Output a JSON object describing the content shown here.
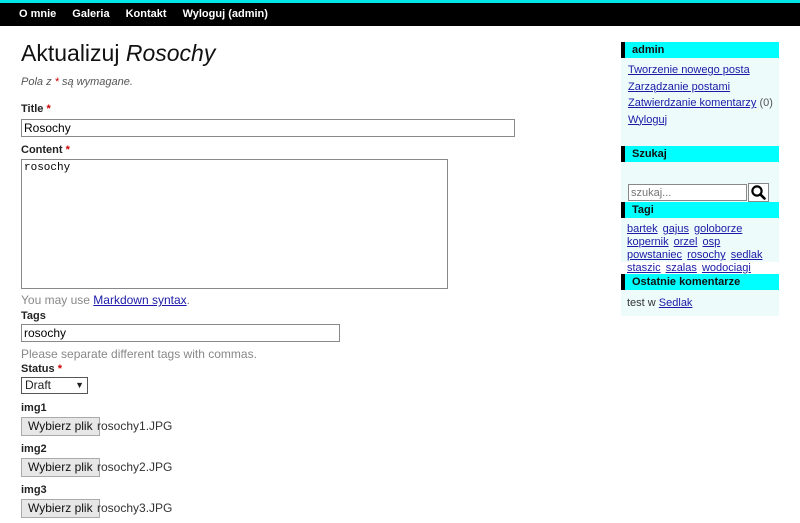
{
  "nav": {
    "items": [
      "O mnie",
      "Galeria",
      "Kontakt",
      "Wyloguj (admin)"
    ]
  },
  "page": {
    "title_prefix": "Aktualizuj ",
    "title_name": "Rosochy",
    "note_before": "Pola z ",
    "note_star": "*",
    "note_after": " są wymagane."
  },
  "form": {
    "title_label": "Title",
    "title_value": "Rosochy",
    "content_label": "Content",
    "content_value": "rosochy",
    "markdown_hint_prefix": "You may use ",
    "markdown_link": "Markdown syntax",
    "markdown_hint_suffix": ".",
    "tags_label": "Tags",
    "tags_value": "rosochy",
    "tags_hint": "Please separate different tags with commas.",
    "status_label": "Status",
    "status_value": "Draft",
    "required_mark": "*",
    "images": [
      {
        "label": "img1",
        "button": "Wybierz plik",
        "file": "rosochy1.JPG"
      },
      {
        "label": "img2",
        "button": "Wybierz plik",
        "file": "rosochy2.JPG"
      },
      {
        "label": "img3",
        "button": "Wybierz plik",
        "file": "rosochy3.JPG"
      }
    ]
  },
  "sidebar": {
    "admin": {
      "title": "admin",
      "links": [
        "Tworzenie nowego posta",
        "Zarządzanie postami",
        "Zatwierdzanie komentarzy",
        "Wyloguj"
      ],
      "pending_count": "(0)"
    },
    "search": {
      "title": "Szukaj",
      "placeholder": "szukaj..."
    },
    "tags": {
      "title": "Tagi",
      "items": [
        "bartek",
        "gajus",
        "goloborze",
        "kopernik",
        "orzel",
        "osp",
        "powstaniec",
        "rosochy",
        "sedlak",
        "staszic",
        "szalas",
        "wodociagi"
      ]
    },
    "recent_comments": {
      "title": "Ostatnie komentarze",
      "author": "test",
      "conj": " w ",
      "post": "Sedlak"
    }
  },
  "colors": {
    "accent": "#00ffff",
    "topbar": "#000000",
    "link": "#1a1aa6",
    "required": "#cc0000",
    "sidebar_bg": "#edfbfb"
  }
}
